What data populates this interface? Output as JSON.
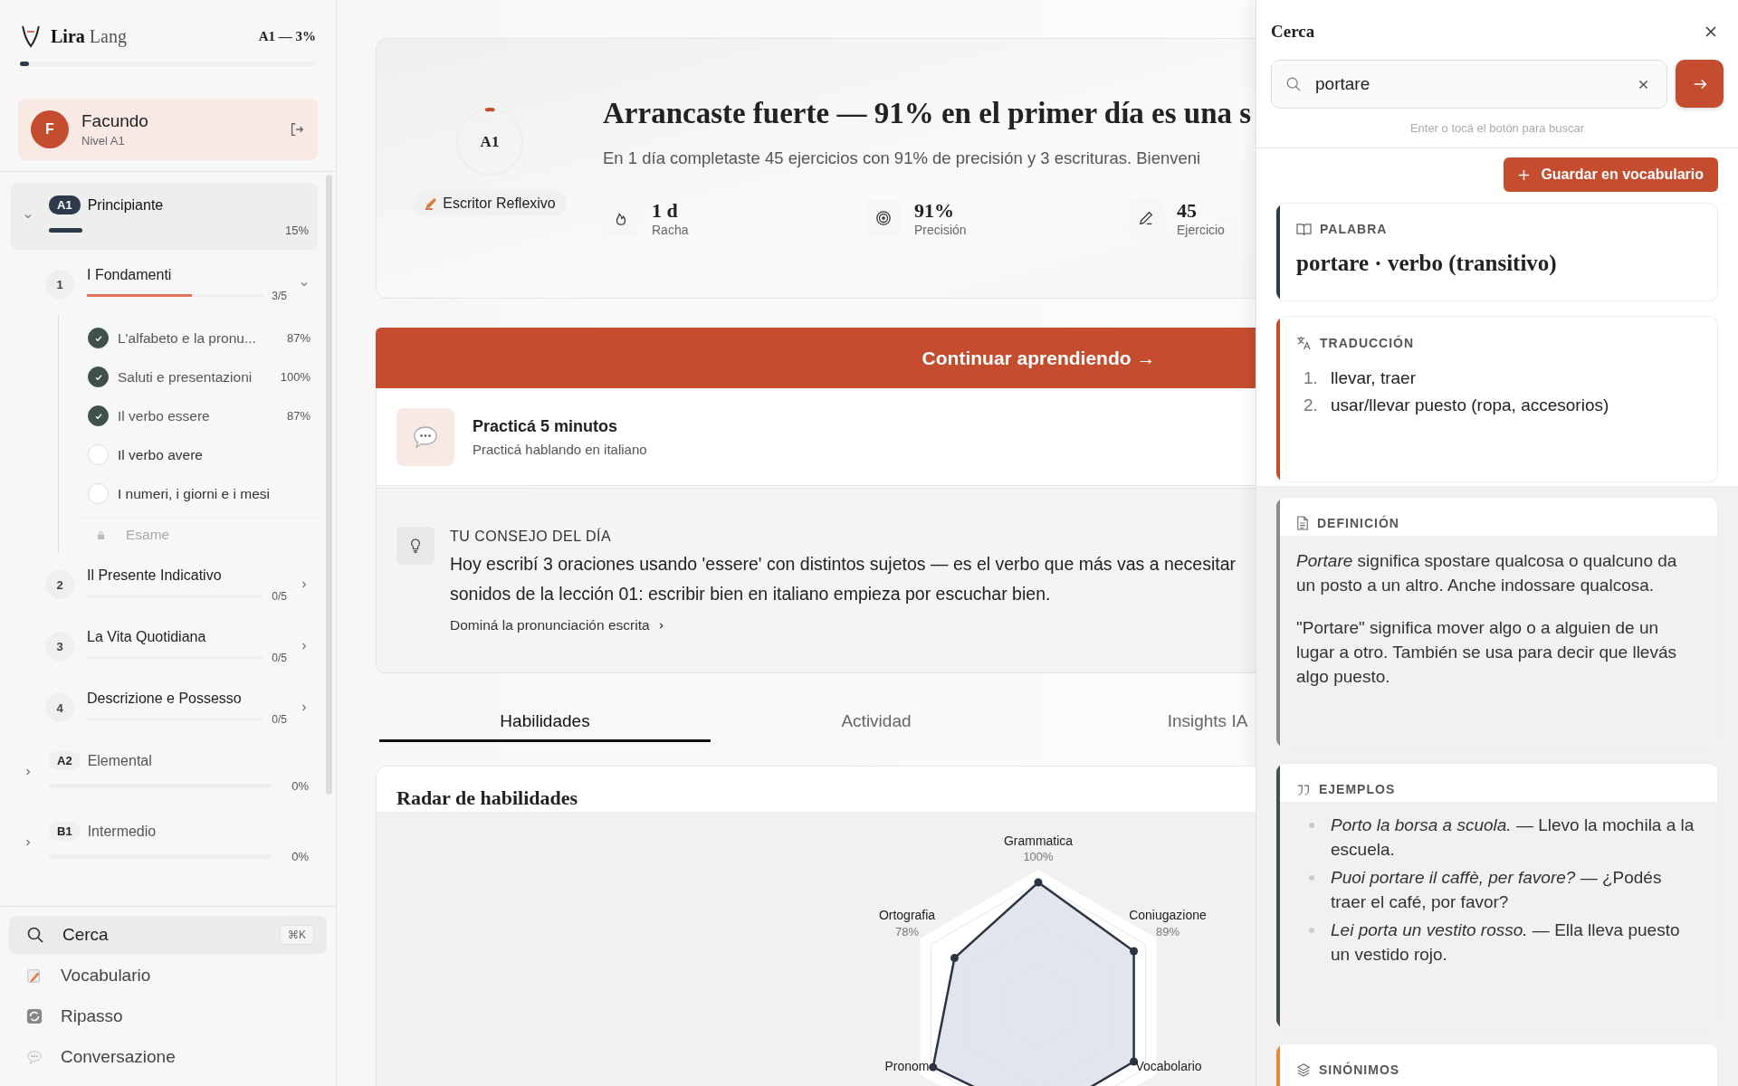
{
  "brand": {
    "name_bold": "Lira",
    "name_light": "Lang",
    "progress_label": "A1 — 3%",
    "level": 0.03
  },
  "user": {
    "initial": "F",
    "name": "Facundo",
    "level_label": "Nivel A1"
  },
  "levels": [
    {
      "code": "A1",
      "name": "Principiante",
      "percent": "15%",
      "level": 0.15,
      "expanded": true,
      "selected": true,
      "children": [
        {
          "number": "1",
          "title": "I Fondamenti",
          "count": "3/5",
          "level": 0.6,
          "expanded": true,
          "children": [
            {
              "kind": "lesson",
              "title": "L'alfabeto e la pronu...",
              "score": "87%",
              "done": true
            },
            {
              "kind": "lesson",
              "title": "Saluti e presentazioni",
              "score": "100%",
              "done": true
            },
            {
              "kind": "lesson",
              "title": "Il verbo essere",
              "score": "87%",
              "done": true
            },
            {
              "kind": "lesson",
              "title": "Il verbo avere",
              "done": false
            },
            {
              "kind": "lesson",
              "title": "I numeri, i giorni e i mesi",
              "done": false
            },
            {
              "kind": "exam",
              "title": "Esame"
            }
          ]
        },
        {
          "number": "2",
          "title": "Il Presente Indicativo",
          "count": "0/5",
          "expanded": false
        },
        {
          "number": "3",
          "title": "La Vita Quotidiana",
          "count": "0/5",
          "expanded": false
        },
        {
          "number": "4",
          "title": "Descrizione e Possesso",
          "count": "0/5",
          "expanded": false
        }
      ]
    },
    {
      "code": "A2",
      "name": "Elemental",
      "percent": "0%",
      "expanded": false,
      "selected": false
    },
    {
      "code": "B1",
      "name": "Intermedio",
      "percent": "0%",
      "expanded": false,
      "selected": false
    }
  ],
  "nav": [
    {
      "kind": "search",
      "label": "Cerca",
      "shortcut": "⌘K",
      "selected": true
    },
    {
      "kind": "vocabulary",
      "label": "Vocabulario",
      "selected": false
    },
    {
      "kind": "review",
      "label": "Ripasso",
      "selected": false
    },
    {
      "kind": "conversation",
      "label": "Conversazione",
      "selected": false
    }
  ],
  "hero": {
    "rank": "A1",
    "level": 0.03,
    "badge": "Escritor Reflexivo",
    "title": "Arrancaste fuerte — 91% en el primer día es una s",
    "summary": "En 1 día completaste 45 ejercicios con 91% de precisión y 3 escrituras. Bienveni",
    "stats": [
      {
        "kind": "streak",
        "value": "1 d",
        "label": "Racha"
      },
      {
        "kind": "accuracy",
        "value": "91%",
        "label": "Precisión"
      },
      {
        "kind": "exercises",
        "value": "45",
        "label": "Ejercicio"
      }
    ]
  },
  "cta": "Continuar aprendiendo →",
  "practice": {
    "title": "Practicá 5 minutos",
    "subtitle": "Practicá hablando en italiano"
  },
  "tip": {
    "heading": "TU CONSEJO DEL DÍA",
    "lines": [
      "Hoy escribí 3 oraciones usando 'essere' con distintos sujetos — es el verbo que más vas a necesitar",
      "sonidos de la lección 01: escribir bien en italiano empieza por escuchar bien."
    ],
    "link": "Dominá la pronunciación escrita"
  },
  "tabs": [
    {
      "label": "Habilidades",
      "selected": true
    },
    {
      "label": "Actividad",
      "selected": false
    },
    {
      "label": "Insights IA",
      "selected": false
    }
  ],
  "radar": {
    "title": "Radar de habilidades",
    "axes": [
      {
        "label": "Grammatica",
        "reading": "100%"
      },
      {
        "label": "Coniugazione",
        "reading": "89%"
      },
      {
        "label": "Vocabolario"
      },
      {
        "label": "Pronom"
      },
      {
        "label": "Ortografia",
        "reading": "78%"
      }
    ]
  },
  "panel": {
    "title": "Cerca",
    "search": {
      "value": "portare"
    },
    "hint": "Enter o tocá el botón para buscar",
    "save_button": "Guardar en vocabulario",
    "sections": [
      {
        "kind": "word",
        "heading": "PALABRA",
        "color": "#2c3a4a",
        "text": "portare · verbo (transitivo)"
      },
      {
        "kind": "translation",
        "heading": "TRADUCCIÓN",
        "color": "#c44d2f",
        "items": [
          {
            "number": "1.",
            "text": "llevar, traer"
          },
          {
            "number": "2.",
            "text": "usar/llevar puesto (ropa, accesorios)"
          }
        ]
      },
      {
        "kind": "definition",
        "heading": "DEFINICIÓN",
        "color": "#8c8c8c",
        "paragraphs": [
          "*Portare* significa spostare qualcosa o qualcuno da un posto a un altro. Anche indossare qualcosa.",
          "\"Portare\" significa mover algo o a alguien de un lugar a otro. También se usa para decir que llevás algo puesto."
        ]
      },
      {
        "kind": "examples",
        "heading": "EJEMPLOS",
        "color": "#3f5149",
        "items": [
          "*Porto la borsa a scuola.* — Llevo la mochila a la escuela.",
          "*Puoi portare il caffè, per favore?* — ¿Podés traer el café, por favor?",
          "*Lei porta un vestito rosso.* — Ella lleva puesto un vestido rojo."
        ]
      },
      {
        "kind": "synonyms",
        "heading": "SINÓNIMOS",
        "color": "#e08a3c"
      }
    ]
  }
}
